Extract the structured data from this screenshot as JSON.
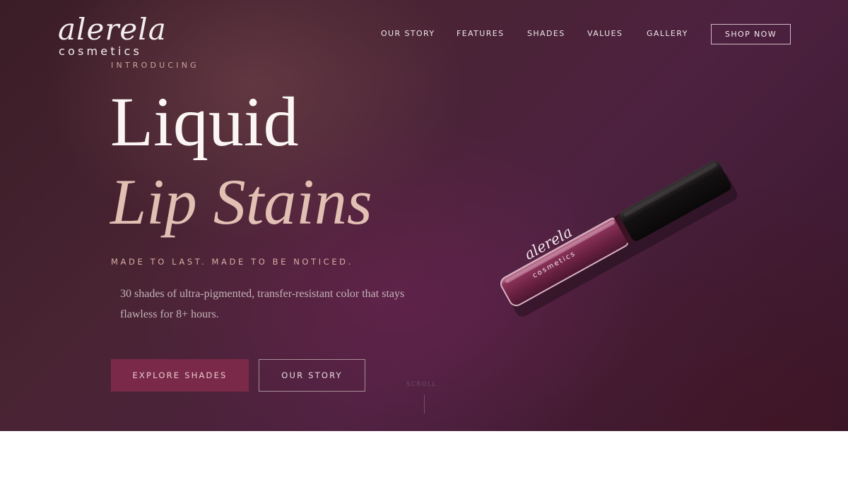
{
  "brand": {
    "script": "alerela",
    "sub": "cosmetics"
  },
  "nav": {
    "items": [
      "OUR STORY",
      "FEATURES",
      "SHADES",
      "VALUES",
      "GALLERY"
    ],
    "cta": "SHOP NOW"
  },
  "hero": {
    "eyebrow": "INTRODUCING",
    "title_line1": "Liquid",
    "title_line2": "Lip Stains",
    "tagline": "MADE TO LAST. MADE TO BE NOTICED.",
    "description": "30 shades of ultra-pigmented, transfer-resistant color that stays flawless for 8+ hours.",
    "primary_button": "EXPLORE SHADES",
    "secondary_button": "OUR STORY",
    "scroll_label": "SCROLL"
  },
  "product": {
    "label_script": "alerela",
    "label_sub": "cosmetics"
  },
  "colors": {
    "background_dark": "#3a1d26",
    "accent_button": "#7a2a48",
    "title_accent": "#e2bfb3",
    "tube_body": "#6e2442",
    "tube_cap": "#161212"
  },
  "icons": {
    "product_image": "lip-stain-tube-image"
  }
}
